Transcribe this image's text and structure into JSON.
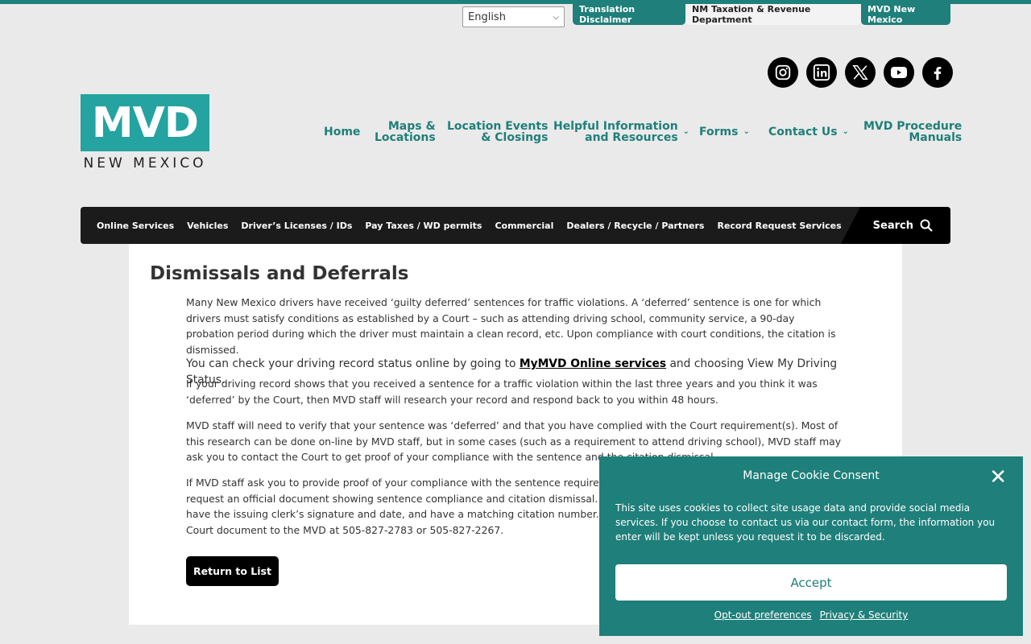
{
  "top_bar": {
    "language": "English",
    "tabs": [
      "Translation Disclaimer",
      "NM Taxation & Revenue Department",
      "MVD New Mexico"
    ]
  },
  "social": [
    "instagram-icon",
    "linkedin-icon",
    "x-icon",
    "youtube-icon",
    "facebook-icon"
  ],
  "logo": {
    "main": "MVD",
    "sub": "NEW MEXICO"
  },
  "main_nav": {
    "home": "Home",
    "maps_1": "Maps &",
    "maps_2": "Locations",
    "events_1": "Location Events",
    "events_2": "& Closings",
    "helpful_1": "Helpful Information",
    "helpful_2": "and Resources",
    "forms": "Forms",
    "contact": "Contact Us",
    "manuals_1": "MVD Procedure",
    "manuals_2": "Manuals"
  },
  "menu_bar": {
    "items": [
      "Online Services",
      "Vehicles",
      "Driver’s Licenses / IDs",
      "Pay Taxes / WD permits",
      "Commercial",
      "Dealers / Recycle / Partners",
      "Record Request Services"
    ],
    "search": "Search"
  },
  "content": {
    "title": "Dismissals and Deferrals",
    "p1": "Many New Mexico drivers have received ‘guilty deferred’ sentences for traffic violations. A ‘deferred’ sentence is one for which drivers must satisfy conditions as established by a Court – such as attending driving school, community service, a 90-day probation period during which the driver must maintain a clean record, etc. Upon compliance with court conditions, the citation is dismissed.",
    "p2_before": "You can check your driving record status online by going to ",
    "p2_link": "MyMVD Online services",
    "p2_after": " and choosing View My Driving Status.",
    "p3": "If your driving record shows that you received a sentence for a traffic violation within the last three years and you think it was ‘deferred’ by the Court, then MVD staff will research your record and respond back to you within 48 hours.",
    "p4": "MVD staff will need to verify that your sentence was ‘deferred’ and that you have complied with the Court requirement(s). Most of this research can be done on-line by MVD staff, but in some cases (such as a requirement to attend driving school), MVD staff may ask you to contact the Court to get proof of your compliance with the sentence and the citation dismissal.",
    "p5": "If MVD staff ask you to provide proof of your compliance with the sentence requirements, you will need to contact the Court and request an official document showing sentence compliance and citation dismissal. The document must be on Court letterhead, have the issuing clerk’s signature and date, and have a matching citation number. You may then mail or fax the original certified Court document to the MVD at 505-827-2783 or 505-827-2267.",
    "return_button": "Return to List"
  },
  "cookie": {
    "title": "Manage Cookie Consent",
    "text": "This site uses cookies to collect site usage data and provide social media services. If you choose to contact us via our contact form, the information you enter will be kept unless you request it to be discarded.",
    "accept": "Accept",
    "optout": "Opt-out preferences",
    "privacy": "Privacy & Security"
  }
}
